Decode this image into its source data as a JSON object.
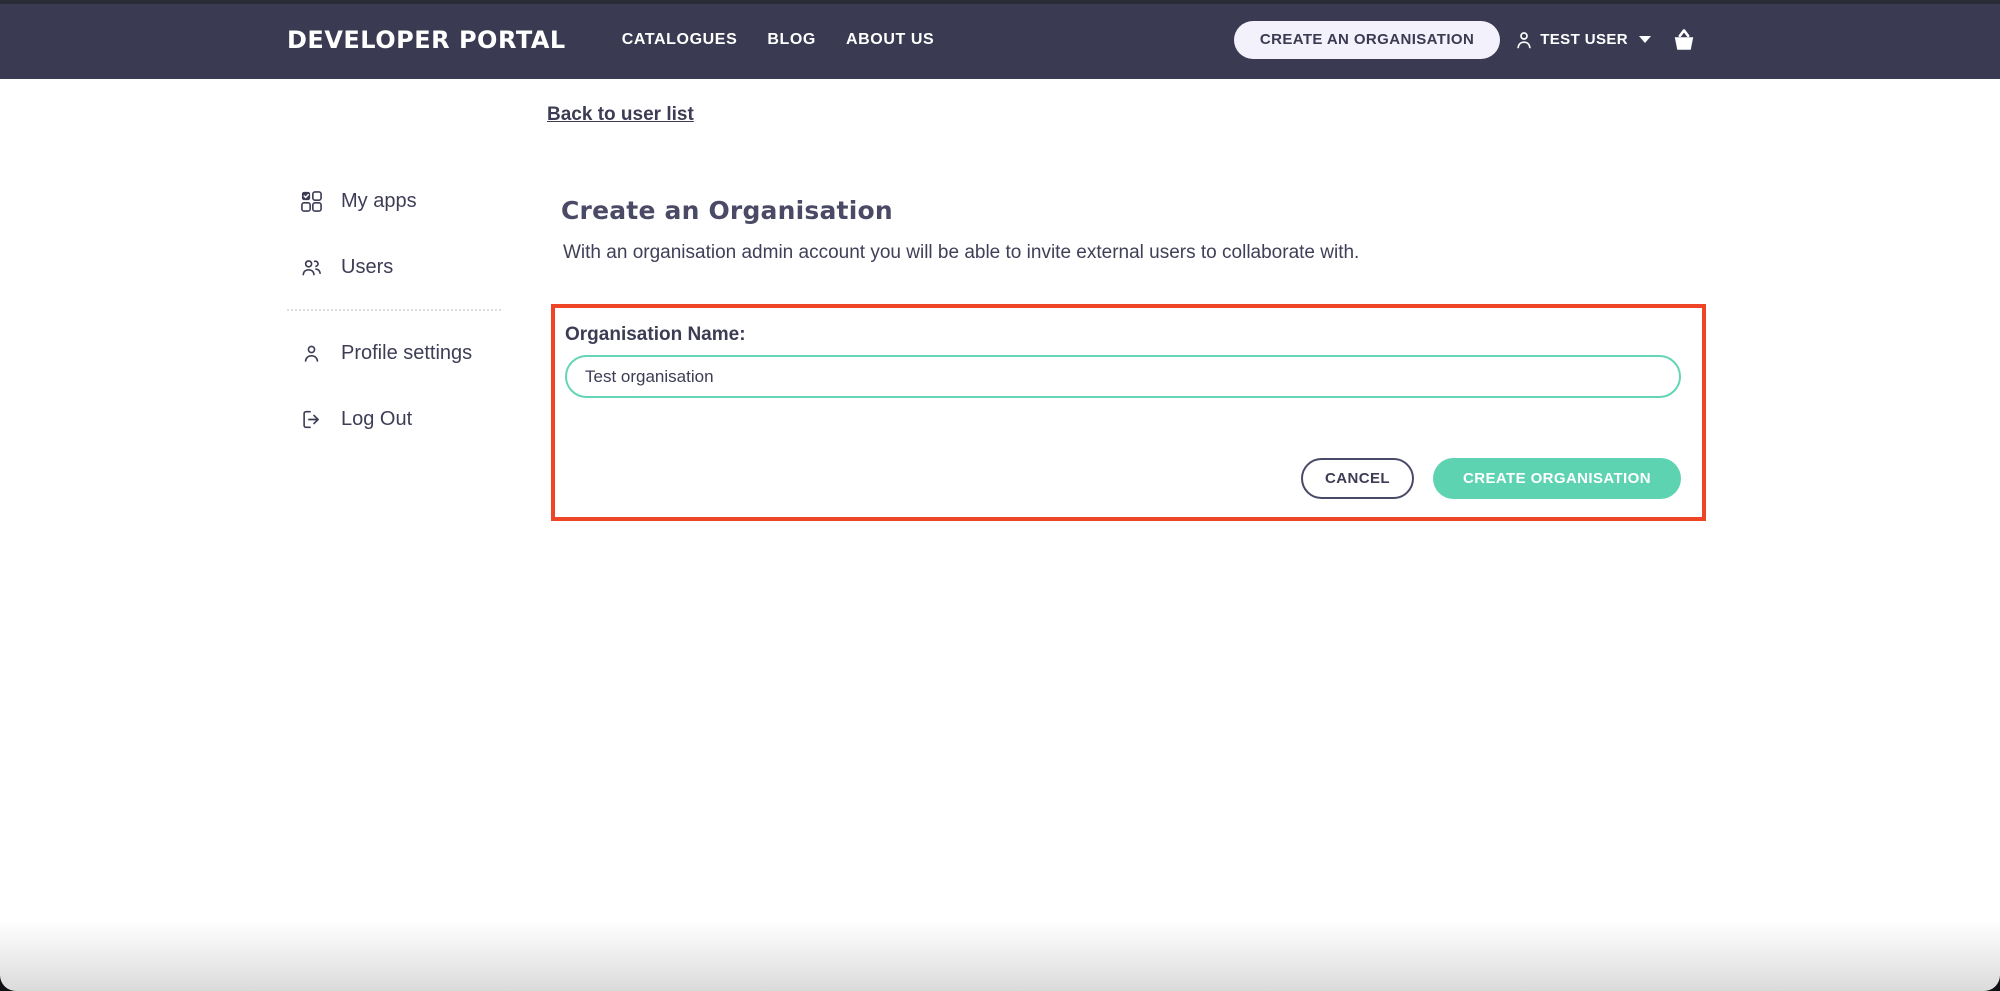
{
  "navbar": {
    "logo": "DEVELOPER PORTAL",
    "links": [
      "CATALOGUES",
      "BLOG",
      "ABOUT US"
    ],
    "create_org_button": "CREATE AN ORGANISATION",
    "user_label": "TEST USER"
  },
  "back_link": "Back to user list",
  "sidebar": {
    "items": [
      {
        "icon": "apps-grid-icon",
        "label": "My apps"
      },
      {
        "icon": "users-icon",
        "label": "Users"
      },
      {
        "icon": "profile-icon",
        "label": "Profile settings"
      },
      {
        "icon": "logout-icon",
        "label": "Log Out"
      }
    ]
  },
  "main": {
    "title": "Create an Organisation",
    "subtitle": "With an organisation admin account you will be able to invite external users to collaborate with.",
    "form": {
      "label": "Organisation Name:",
      "value": "Test organisation",
      "cancel": "CANCEL",
      "submit": "CREATE ORGANISATION"
    }
  },
  "colors": {
    "navbar_bg": "#3a3a52",
    "accent_teal": "#5ed3b2",
    "input_border_teal": "#66d4b6",
    "highlight_red": "#ee4527",
    "text_dark": "#3c3c55",
    "nav_pill_bg": "#f3f1fb"
  }
}
